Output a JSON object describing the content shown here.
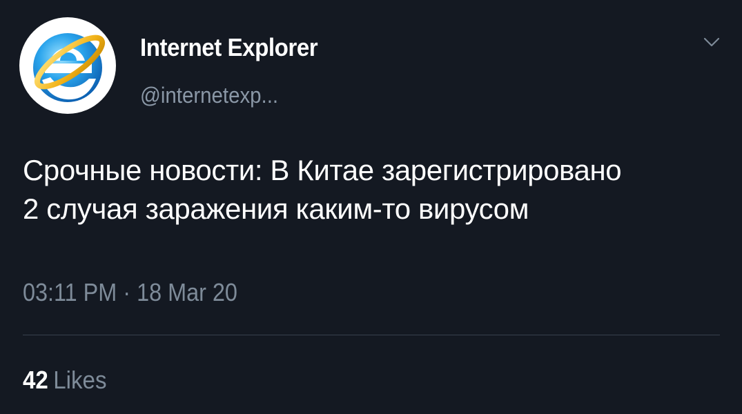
{
  "tweet": {
    "author": {
      "display_name": "Internet Explorer",
      "handle": "@internetexp...",
      "avatar_icon": "internet-explorer-logo-icon"
    },
    "menu_icon": "chevron-down-icon",
    "text_lines": [
      "Срочные новости: В Китае зарегистрировано",
      "2 случая заражения каким-то вирусом"
    ],
    "timestamp": "03:11 PM · 18 Mar 20",
    "likes": {
      "count": "42",
      "label": "Likes"
    }
  },
  "colors": {
    "background": "#141922",
    "primary_text": "#ffffff",
    "secondary_text": "#7e8b99",
    "divider": "#38414d",
    "logo_blue": "#1a8fe0",
    "logo_gold": "#f2b31a"
  }
}
